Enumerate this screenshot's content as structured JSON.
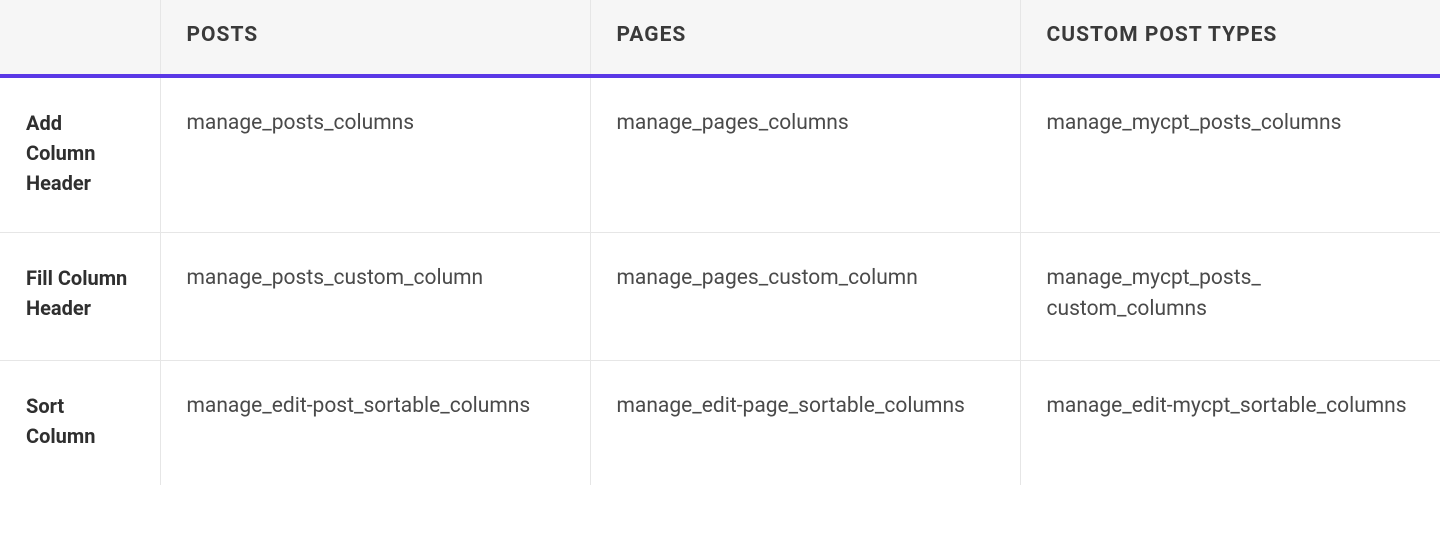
{
  "table": {
    "headers": {
      "blank": "",
      "posts": "POSTS",
      "pages": "PAGES",
      "cpt": "CUSTOM POST TYPES"
    },
    "rows": [
      {
        "label": "Add Column Header",
        "posts": "manage_posts_columns",
        "pages": "manage_pages_columns",
        "cpt": "manage_mycpt_posts_​columns"
      },
      {
        "label": "Fill Column Header",
        "posts": "manage_posts_custom_​column",
        "pages": "manage_pages_custom_​column",
        "cpt": "manage_mycpt_posts_​custom_columns"
      },
      {
        "label": "Sort Column",
        "posts": "manage_edit-post_sortable​_columns",
        "pages": "manage_edit-page_sortable​_columns",
        "cpt": "manage_edit-mycpt_​sortable_columns"
      }
    ]
  }
}
